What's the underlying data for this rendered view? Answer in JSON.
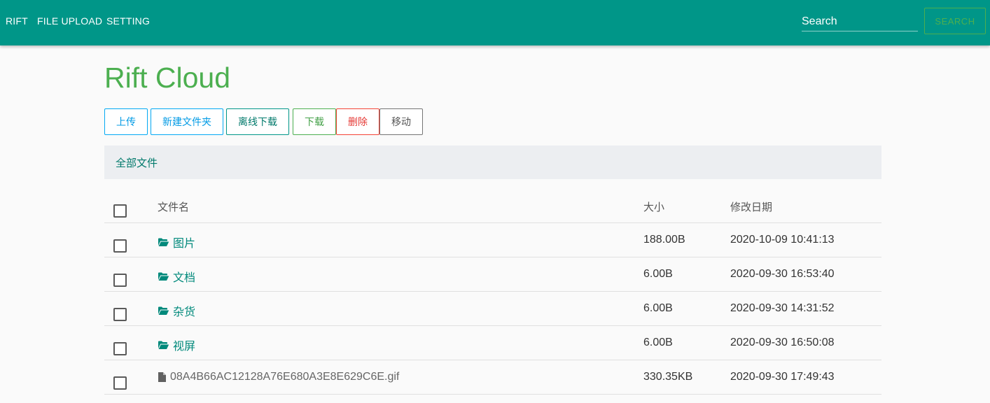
{
  "nav": {
    "brand": "RIFT",
    "links": [
      "FILE UPLOAD",
      "SETTING"
    ],
    "search_placeholder": "Search",
    "search_button": "SEARCH"
  },
  "page": {
    "title": "Rift Cloud"
  },
  "toolbar": {
    "upload": "上传",
    "new_folder": "新建文件夹",
    "offline_download": "离线下载",
    "download": "下载",
    "delete": "删除",
    "move": "移动"
  },
  "breadcrumb": {
    "root": "全部文件"
  },
  "table": {
    "columns": [
      "文件名",
      "大小",
      "修改日期"
    ],
    "rows": [
      {
        "name": "图片",
        "type": "folder",
        "size": "188.00B",
        "date": "2020-10-09 10:41:13"
      },
      {
        "name": "文档",
        "type": "folder",
        "size": "6.00B",
        "date": "2020-09-30 16:53:40"
      },
      {
        "name": "杂货",
        "type": "folder",
        "size": "6.00B",
        "date": "2020-09-30 14:31:52"
      },
      {
        "name": "视屏",
        "type": "folder",
        "size": "6.00B",
        "date": "2020-09-30 16:50:08"
      },
      {
        "name": "08A4B66AC12128A76E680A3E8E629C6E.gif",
        "type": "file",
        "size": "330.35KB",
        "date": "2020-09-30 17:49:43"
      }
    ]
  },
  "colors": {
    "navbar": "#009688",
    "title": "#4caf50",
    "folder": "#00897b",
    "delete": "#f44336"
  },
  "icons": {
    "folder": "folder-open-icon",
    "file": "file-icon"
  }
}
